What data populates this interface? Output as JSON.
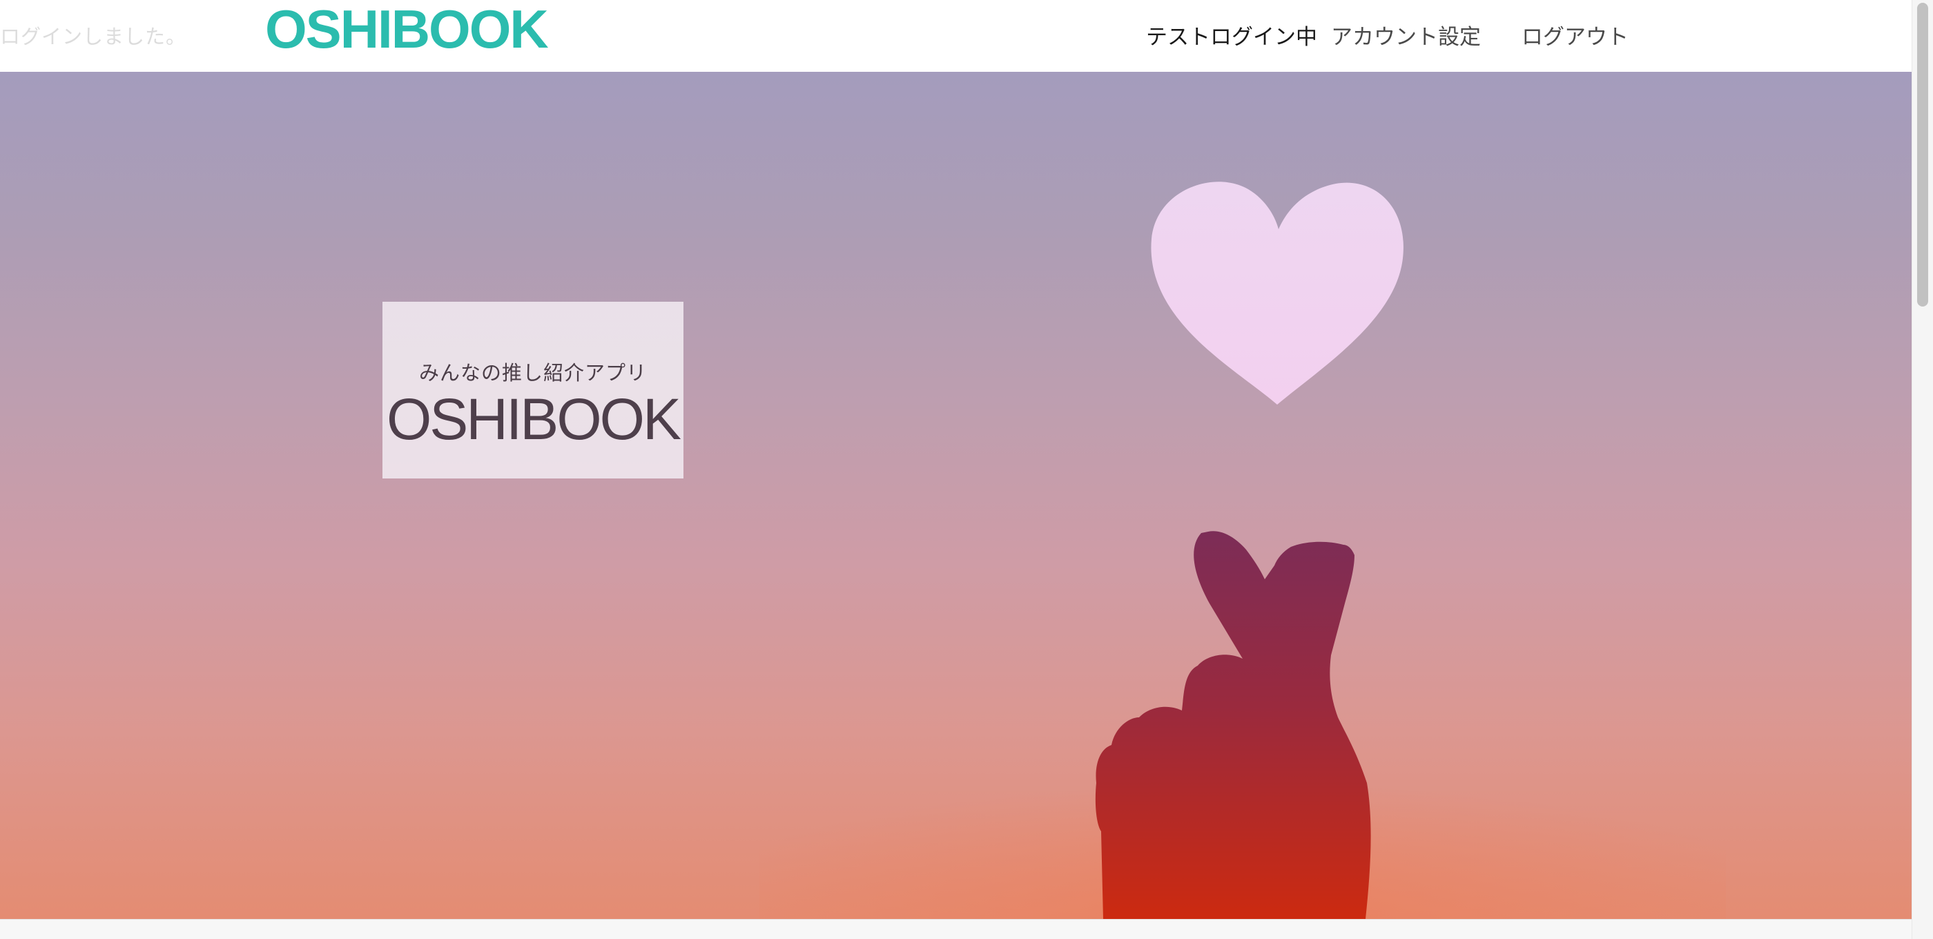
{
  "header": {
    "flash_message": "ログインしました。",
    "logo": "OSHIBOOK",
    "nav": {
      "test_login": "テストログイン中",
      "account_settings": "アカウント設定",
      "logout": "ログアウト"
    }
  },
  "hero": {
    "subtitle": "みんなの推し紹介アプリ",
    "title": "OSHIBOOK",
    "image_subject": "finger-heart-hand-silhouette"
  },
  "colors": {
    "brand": "#2bbcae",
    "heart": "#f1d4ef",
    "hand_top": "#7c2d57",
    "hand_bottom": "#cc2a10"
  }
}
